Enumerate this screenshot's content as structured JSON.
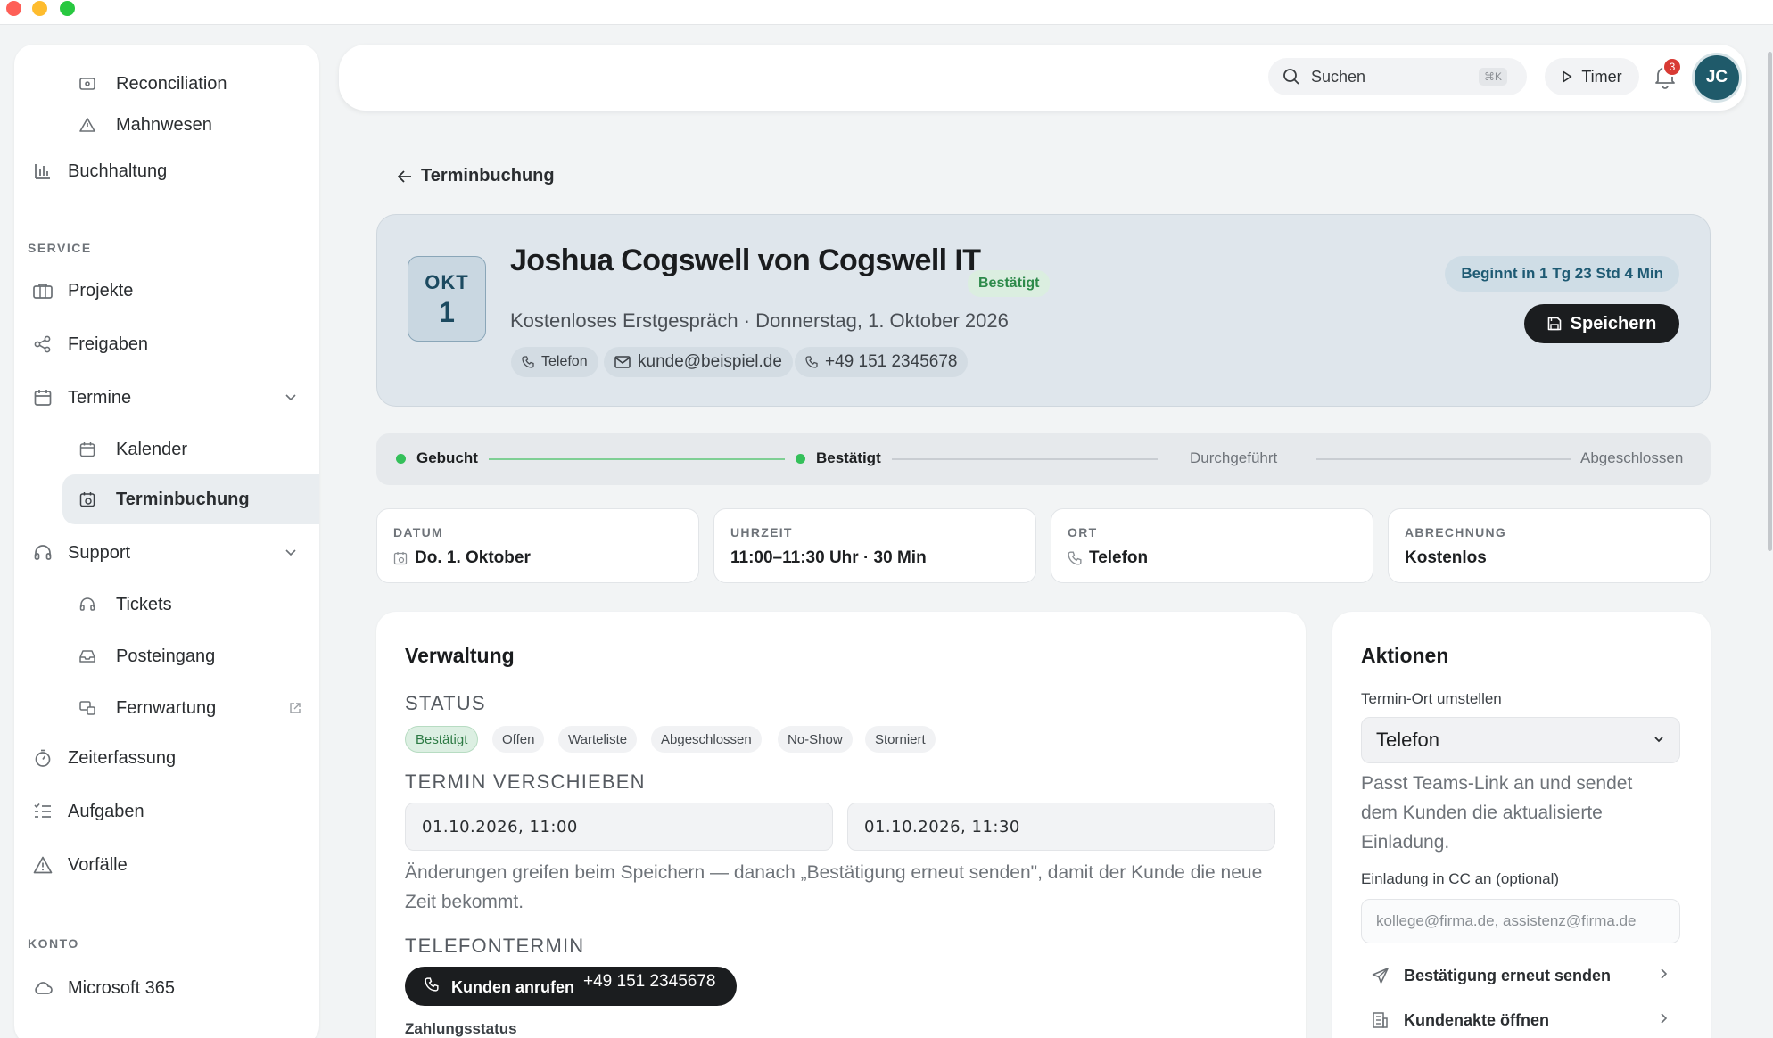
{
  "sidebar": {
    "items": [
      {
        "label": "Reconciliation",
        "icon": "receipt-icon"
      },
      {
        "label": "Mahnwesen",
        "icon": "warning-icon"
      },
      {
        "label": "Buchhaltung",
        "icon": "bar-chart-icon"
      },
      {
        "label": "Projekte",
        "icon": "briefcase-icon"
      },
      {
        "label": "Freigaben",
        "icon": "share-icon"
      },
      {
        "label": "Termine",
        "icon": "calendar-icon"
      },
      {
        "label": "Kalender",
        "icon": "calendar-icon"
      },
      {
        "label": "Terminbuchung",
        "icon": "calendar-clock-icon"
      },
      {
        "label": "Support",
        "icon": "headset-icon"
      },
      {
        "label": "Tickets",
        "icon": "headset-icon"
      },
      {
        "label": "Posteingang",
        "icon": "inbox-icon"
      },
      {
        "label": "Fernwartung",
        "icon": "remote-icon"
      },
      {
        "label": "Zeiterfassung",
        "icon": "stopwatch-icon"
      },
      {
        "label": "Aufgaben",
        "icon": "list-icon"
      },
      {
        "label": "Vorfälle",
        "icon": "warning-icon"
      },
      {
        "label": "Microsoft 365",
        "icon": "cloud-icon"
      }
    ],
    "section_service": "SERVICE",
    "section_konto": "KONTO",
    "active_item": "Terminbuchung"
  },
  "topbar": {
    "search_placeholder": "Suchen",
    "search_shortcut": "⌘K",
    "timer_label": "Timer",
    "notification_count": "3",
    "avatar_initials": "JC"
  },
  "breadcrumb": {
    "back_label": "Terminbuchung"
  },
  "appointment": {
    "month": "OKT",
    "day": "1",
    "title": "Joshua Cogswell von Cogswell IT",
    "status": "Bestätigt",
    "subtitle": "Kostenloses Erstgespräch · Donnerstag, 1. Oktober 2026",
    "channel": "Telefon",
    "email": "kunde@beispiel.de",
    "phone": "+49 151 2345678",
    "countdown": "Beginnt in 1 Tg 23 Std 4 Min",
    "save_label": "Speichern"
  },
  "progress": {
    "steps": [
      {
        "label": "Gebucht",
        "done": true
      },
      {
        "label": "Bestätigt",
        "done": true
      },
      {
        "label": "Durchgeführt",
        "done": false
      },
      {
        "label": "Abgeschlossen",
        "done": false
      }
    ]
  },
  "stats": [
    {
      "label": "DATUM",
      "value": "Do. 1. Oktober",
      "icon": "calendar-icon"
    },
    {
      "label": "UHRZEIT",
      "value": "11:00–11:30 Uhr · 30 Min"
    },
    {
      "label": "ORT",
      "value": "Telefon",
      "icon": "phone-icon"
    },
    {
      "label": "ABRECHNUNG",
      "value": "Kostenlos"
    }
  ],
  "verwaltung": {
    "title": "Verwaltung",
    "status_heading": "STATUS",
    "status_options": [
      "Bestätigt",
      "Offen",
      "Warteliste",
      "Abgeschlossen",
      "No-Show",
      "Storniert"
    ],
    "selected_status": "Bestätigt",
    "reschedule_heading": "TERMIN VERSCHIEBEN",
    "start_value": "01.10.2026, 11:00",
    "end_value": "01.10.2026, 11:30",
    "reschedule_hint": "Änderungen greifen beim Speichern — danach „Bestätigung erneut senden\", damit der Kunde die neue Zeit bekommt.",
    "phone_heading": "TELEFONTERMIN",
    "call_label": "Kunden anrufen ·",
    "call_number": "+49 151 2345678",
    "payment_label": "Zahlungsstatus"
  },
  "aktionen": {
    "title": "Aktionen",
    "location_label": "Termin-Ort umstellen",
    "location_value": "Telefon",
    "location_hint": "Passt Teams-Link an und sendet dem Kunden die aktualisierte Einladung.",
    "cc_label": "Einladung in CC an (optional)",
    "cc_placeholder": "kollege@firma.de, assistenz@firma.de",
    "actions": [
      {
        "label": "Bestätigung erneut senden",
        "icon": "send-icon"
      },
      {
        "label": "Kundenakte öffnen",
        "icon": "building-icon"
      }
    ]
  },
  "colors": {
    "accent_dark": "#1b1d1f",
    "success": "#34c05a",
    "avatar": "#1f5a6a",
    "badge": "#d83a34"
  }
}
